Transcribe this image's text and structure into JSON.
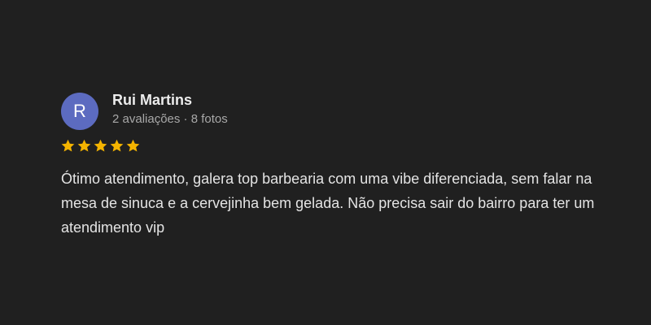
{
  "review": {
    "avatar_letter": "R",
    "avatar_color": "#5c6bc0",
    "reviewer_name": "Rui Martins",
    "reviewer_meta": "2 avaliações · 8 fotos",
    "rating": 5,
    "rating_max": 5,
    "star_color": "#f4b400",
    "text": "Ótimo atendimento, galera top barbearia com uma vibe diferenciada, sem falar na mesa de sinuca e a cervejinha bem gelada. Não precisa sair do bairro para ter um atendimento vip"
  }
}
